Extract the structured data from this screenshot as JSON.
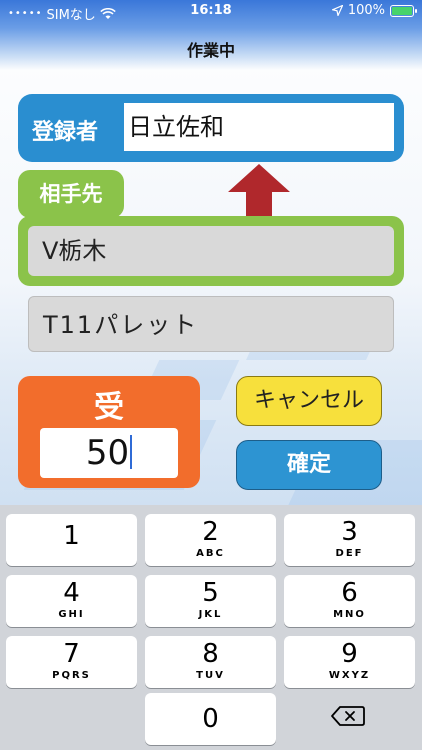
{
  "status_bar": {
    "carrier": "SIMなし",
    "time": "16:18",
    "battery": "100%",
    "icons": [
      "signal-dots-icon",
      "wifi-icon",
      "location-arrow-icon",
      "battery-charging-icon"
    ]
  },
  "header": {
    "title": "作業中"
  },
  "registrant": {
    "label": "登録者",
    "value": "日立佐和"
  },
  "partner": {
    "label": "相手先",
    "value": "V栃木"
  },
  "item": {
    "value": "T11パレット"
  },
  "receive": {
    "label": "受",
    "value": "50"
  },
  "buttons": {
    "cancel": "キャンセル",
    "confirm": "確定"
  },
  "keypad": {
    "keys": [
      {
        "num": "1",
        "letters": ""
      },
      {
        "num": "2",
        "letters": "ABC"
      },
      {
        "num": "3",
        "letters": "DEF"
      },
      {
        "num": "4",
        "letters": "GHI"
      },
      {
        "num": "5",
        "letters": "JKL"
      },
      {
        "num": "6",
        "letters": "MNO"
      },
      {
        "num": "7",
        "letters": "PQRS"
      },
      {
        "num": "8",
        "letters": "TUV"
      },
      {
        "num": "9",
        "letters": "WXYZ"
      },
      {
        "num": "0",
        "letters": ""
      }
    ],
    "delete_icon": "backspace-icon"
  },
  "colors": {
    "registrant": "#2a8ed0",
    "partner": "#8bc34a",
    "receive": "#f26d2c",
    "cancel": "#f7e03c",
    "confirm": "#2d94d2",
    "arrow": "#b0282c"
  }
}
